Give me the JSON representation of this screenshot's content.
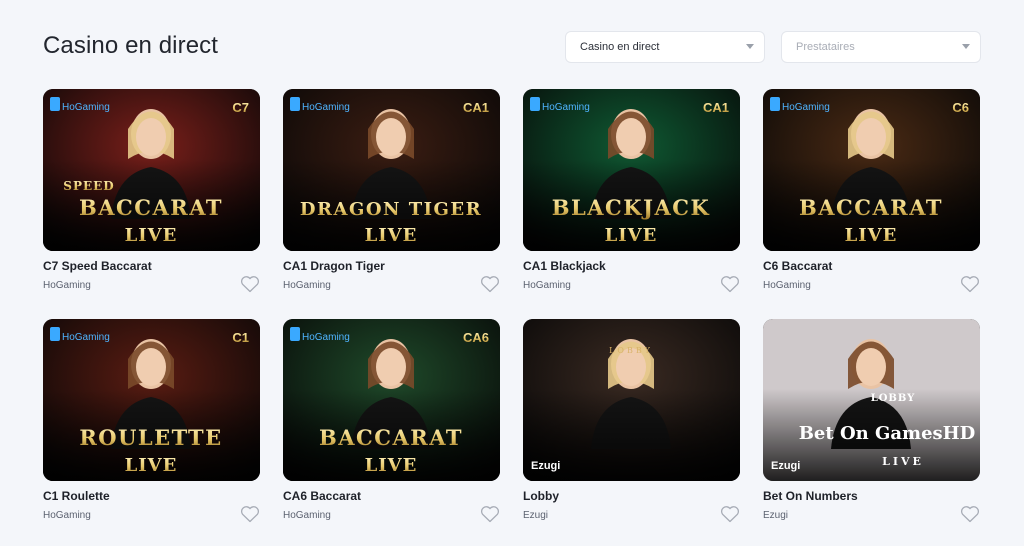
{
  "page": {
    "title": "Casino en direct"
  },
  "filters": {
    "category": {
      "value": "Casino en direct"
    },
    "provider": {
      "placeholder": "Prestataires"
    }
  },
  "games": [
    {
      "name": "C7 Speed Baccarat",
      "provider": "HoGaming",
      "badge": "C7",
      "line1": "SPEED",
      "line2": "BACCARAT",
      "line3": "LIVE",
      "theme": "#7a1f1a"
    },
    {
      "name": "CA1 Dragon Tiger",
      "provider": "HoGaming",
      "badge": "CA1",
      "line1": "",
      "line2": "DRAGON TIGER",
      "line3": "LIVE",
      "theme": "#3b1d12"
    },
    {
      "name": "CA1 Blackjack",
      "provider": "HoGaming",
      "badge": "CA1",
      "line1": "",
      "line2": "BLACKJACK",
      "line3": "LIVE",
      "theme": "#0f5a33"
    },
    {
      "name": "C6 Baccarat",
      "provider": "HoGaming",
      "badge": "C6",
      "line1": "",
      "line2": "BACCARAT",
      "line3": "LIVE",
      "theme": "#4a2a14"
    },
    {
      "name": "C1 Roulette",
      "provider": "HoGaming",
      "badge": "C1",
      "line1": "",
      "line2": "ROULETTE",
      "line3": "LIVE",
      "theme": "#5a1c12"
    },
    {
      "name": "CA6 Baccarat",
      "provider": "HoGaming",
      "badge": "CA6",
      "line1": "",
      "line2": "BACCARAT",
      "line3": "LIVE",
      "theme": "#1f4a2a"
    },
    {
      "name": "Lobby",
      "provider": "Ezugi",
      "badge": "",
      "line1": "",
      "line2": "LOBBY",
      "line3": "",
      "theme": "#3a2a22"
    },
    {
      "name": "Bet On Numbers",
      "provider": "Ezugi",
      "badge": "",
      "line1": "LOBBY",
      "line2": "Bet On GamesHD",
      "line3": "LIVE",
      "theme": "#b9b5b8"
    }
  ],
  "thumb_brand": {
    "hogaming": "HoGaming",
    "ezugi": "Ezugi"
  },
  "icons": {
    "favorite": "heart-outline-icon",
    "dropdown": "caret-down-icon"
  },
  "colors": {
    "background": "#f4f6fa",
    "gold": "#e8c96a",
    "card_text": "#1e2129"
  }
}
